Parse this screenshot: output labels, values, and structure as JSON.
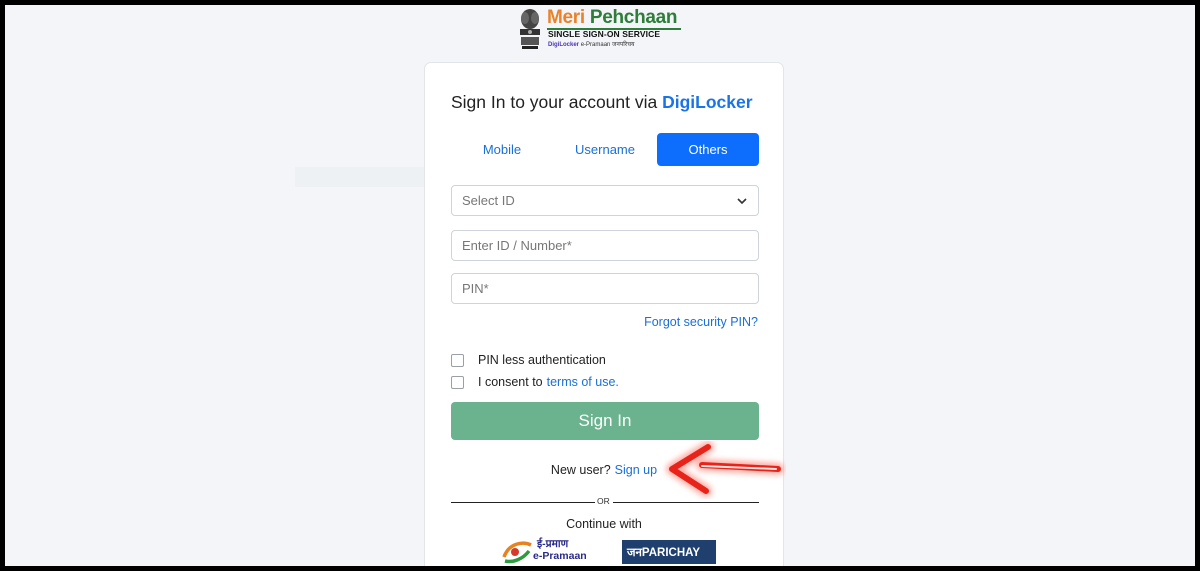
{
  "header": {
    "brand_meri": "Meri",
    "brand_pehchaan": "Pehchaan",
    "brand_sub": "SINGLE SIGN-ON SERVICE",
    "partner_digilocker": "DigiLocker",
    "partner_epramaan": "e-Pramaan",
    "partner_janparichay": "जनपरिचय"
  },
  "card": {
    "title_prefix": "Sign In to your account via",
    "title_brand": "DigiLocker",
    "tabs": [
      {
        "label": "Mobile",
        "active": false
      },
      {
        "label": "Username",
        "active": false
      },
      {
        "label": "Others",
        "active": true
      }
    ],
    "select_id": {
      "value": "Select ID"
    },
    "id_number": {
      "placeholder": "Enter ID / Number*"
    },
    "pin": {
      "placeholder": "PIN*"
    },
    "forgot_pin": "Forgot security PIN?",
    "pinless_label": "PIN less authentication",
    "consent_prefix": "I consent to",
    "consent_link": "terms of use.",
    "signin_label": "Sign In",
    "new_user_prefix": "New user?",
    "signup_link": "Sign up",
    "or_text": "OR",
    "continue_with": "Continue with",
    "epramaan_hi": "ई-प्रमाण",
    "epramaan_en": "e-Pramaan",
    "janparichay_label": "जनPARICHAY"
  },
  "annotation": {
    "arrow_color": "#e8231a"
  },
  "colors": {
    "accent": "#0d6efd",
    "signin_button": "#6bb28e",
    "link": "#1a6fd8"
  }
}
